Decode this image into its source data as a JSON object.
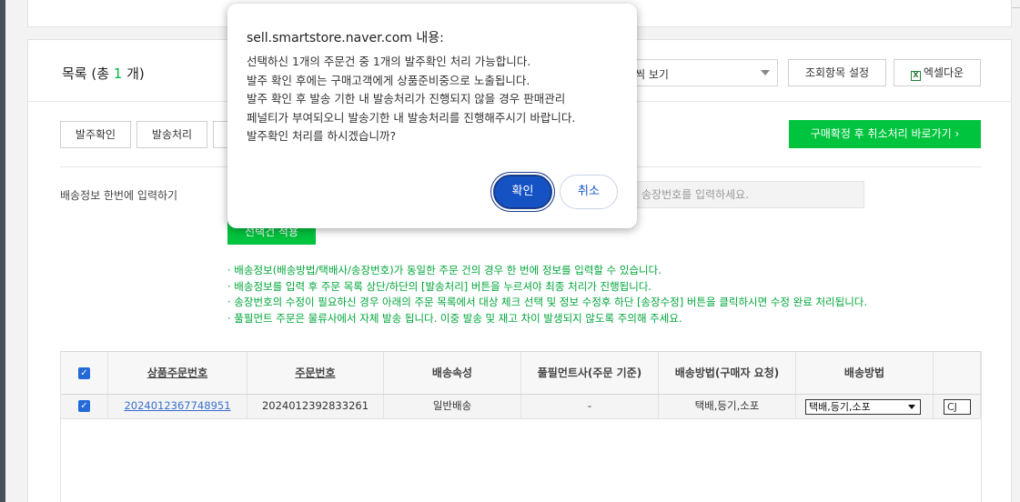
{
  "list": {
    "title_prefix": "목록 (총 ",
    "count": "1",
    "title_suffix": " 개)",
    "view_select": "씩 보기",
    "column_settings_button": "조회항목 설정",
    "excel_button": "엑셀다운",
    "excel_icon_glyph": "X"
  },
  "actions": {
    "confirm_order_button": "발주확인",
    "ship_button": "발송처리",
    "green_button": "구매확정 후 취소처리 바로가기 ›",
    "ship_info_label": "배송정보 한번에 입력하기",
    "tracking_placeholder": "송장번호를 입력하세요.",
    "apply_button": "선택건 적용"
  },
  "notices": [
    "· 배송정보(배송방법/택배사/송장번호)가 동일한 주문 건의 경우 한 번에 정보를 입력할 수 있습니다.",
    "· 배송정보를 입력 후 주문 목록 상단/하단의 [발송처리] 버튼을 누르셔야 최종 처리가 진행됩니다.",
    "· 송장번호의 수정이 필요하신 경우 아래의 주문 목록에서 대상 체크 선택 및 정보 수정후 하단 [송장수정] 버튼을 클릭하시면 수정 완료 처리됩니다.",
    "· 풀필먼트 주문은 물류사에서 자체 발송 됩니다. 이중 발송 및 재고 차이 발생되지 않도록 주의해 주세요."
  ],
  "table": {
    "headers": [
      "상품주문번호",
      "주문번호",
      "배송속성",
      "풀필먼트사(주문 기준)",
      "배송방법(구매자 요청)",
      "배송방법"
    ],
    "row": {
      "product_order_no": "2024012367748951",
      "order_no": "2024012392833261",
      "ship_attr": "일반배송",
      "fulfillment": "-",
      "ship_method_req": "택배,등기,소포",
      "ship_method_select": "택배,등기,소포",
      "courier_partial": "CJ"
    }
  },
  "dialog": {
    "title": "sell.smartstore.naver.com 내용:",
    "message": "선택하신 1개의 주문건 중 1개의 발주확인 처리 가능합니다.\n발주 확인 후에는 구매고객에게 상품준비중으로 노출됩니다.\n발주 확인 후 발송 기한 내 발송처리가 진행되지 않을 경우 판매관리\n페널티가 부여되오니 발송기한 내 발송처리를 진행해주시기 바랍니다.\n발주확인 처리를 하시겠습니까?",
    "ok": "확인",
    "cancel": "취소"
  }
}
